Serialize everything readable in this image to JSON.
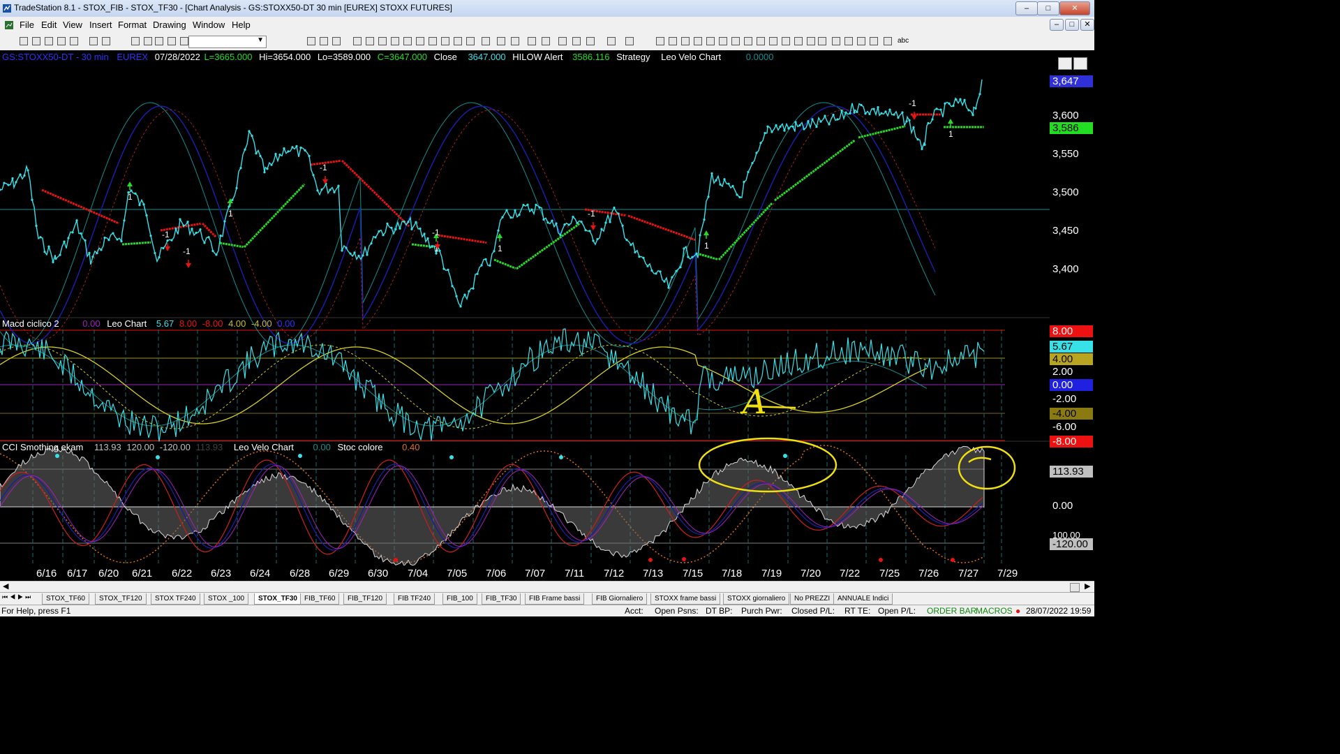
{
  "window": {
    "title": "TradeStation 8.1 - STOX_FIB - STOX_TF30 - [Chart Analysis - GS:STOXX50-DT  30 min  [EUREX] STOXX FUTURES]"
  },
  "menu": [
    "File",
    "Edit",
    "View",
    "Insert",
    "Format",
    "Drawing",
    "Window",
    "Help"
  ],
  "toolbar": {
    "draw_text_icon": "abc"
  },
  "price_panel": {
    "symbol": "GS:STOXX50-DT - 30 min",
    "exchange": "EUREX",
    "date": "07/28/2022",
    "last": "L=3665.000",
    "high": "Hi=3654.000",
    "low": "Lo=3589.000",
    "close_eq": "C=3647.000",
    "close_label": "Close",
    "close_value": "3647.000",
    "hilow_label": "HILOW Alert",
    "hilow_value": "3586.116",
    "strategy_label": "Strategy",
    "velo_label": "Leo Velo Chart",
    "velo_value": "0.0000",
    "y_ticks": [
      "3,600",
      "3,550",
      "3,500",
      "3,450",
      "3,400"
    ],
    "last_badge": "3,647",
    "hilow_badge": "3,586",
    "signal_up": "1",
    "signal_down": "-1"
  },
  "macd_panel": {
    "title": "Macd ciclico 2",
    "v0": "0.00",
    "leo_label": "Leo Chart",
    "v1": "5.67",
    "v2": "8.00",
    "v3": "-8.00",
    "v4": "4.00",
    "v5": "-4.00",
    "v6": "0.00",
    "y_ticks": [
      "8.00",
      "5.67",
      "4.00",
      "2.00",
      "0.00",
      "-2.00",
      "-4.00",
      "-6.00",
      "-8.00"
    ],
    "annotation": "A"
  },
  "cci_panel": {
    "title": "CCI Smothing ekam",
    "v0": "113.93",
    "v1": "120.00",
    "v2": "-120.00",
    "v3": "113.93",
    "velo_label": "Leo Velo Chart",
    "velo_value": "0.00",
    "stoc_label": "Stoc colore",
    "stoc_value": "0.40",
    "y_ticks": [
      "113.93",
      "0.00",
      "100.00",
      "-120.00"
    ]
  },
  "x_axis": [
    "6/16",
    "6/17",
    "6/20",
    "6/21",
    "6/22",
    "6/23",
    "6/24",
    "6/28",
    "6/29",
    "6/30",
    "7/04",
    "7/05",
    "7/06",
    "7/07",
    "7/11",
    "7/12",
    "7/13",
    "7/15",
    "7/18",
    "7/19",
    "7/20",
    "7/22",
    "7/25",
    "7/26",
    "7/27",
    "7/29"
  ],
  "tabs": [
    "STOX_TF60",
    "STOX_TF120",
    "STOX TF240",
    "STOX _100",
    "STOX_TF30",
    "FIB_TF60",
    "FIB_TF120",
    "FIB TF240",
    "FIB_100",
    "FIB_TF30",
    "FIB Frame bassi",
    "FIB Giornaliero",
    "STOXX frame bassi",
    "STOXX giornaliero",
    "No PREZZI",
    "ANNUALE Indici"
  ],
  "active_tab": "STOX_TF30",
  "status": {
    "help": "For Help, press F1",
    "acct": "Acct:",
    "open_psns": "Open Psns:",
    "dt_bp": "DT BP:",
    "purch_pwr": "Purch Pwr:",
    "closed_pl": "Closed P/L:",
    "rt_te": "RT TE:",
    "open_pl": "Open P/L:",
    "order_bar": "ORDER BAR",
    "macros": "MACROS",
    "datetime": "28/07/2022 19:59"
  },
  "colors": {
    "cyan": "#38e0e8",
    "green": "#22dd22",
    "red": "#ee1111",
    "navy": "#1c1ca8",
    "teal": "#108f8f",
    "yellow": "#e8e420",
    "orange": "#e07010",
    "purple": "#a020c0"
  }
}
